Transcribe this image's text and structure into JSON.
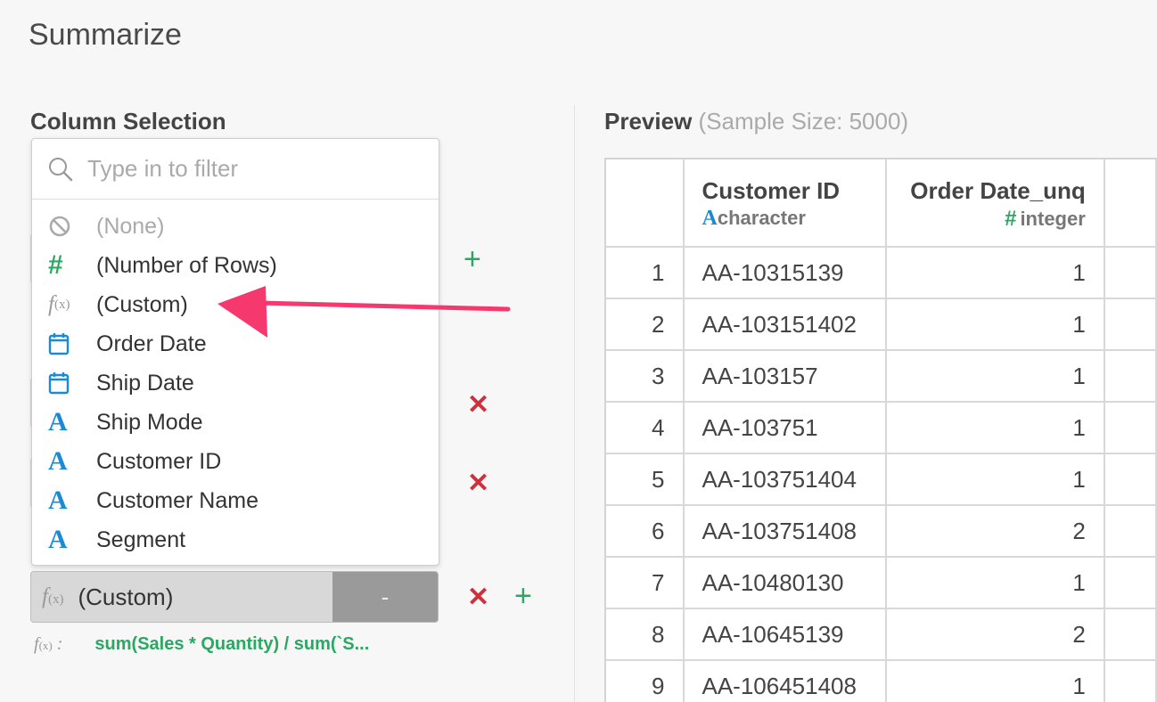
{
  "page": {
    "title": "Summarize"
  },
  "column_selection": {
    "title": "Column Selection",
    "search": {
      "placeholder": "Type in to filter",
      "value": ""
    },
    "options": [
      {
        "label": "(None)",
        "icon": "none-icon"
      },
      {
        "label": "(Number of Rows)",
        "icon": "hash-icon"
      },
      {
        "label": "(Custom)",
        "icon": "function-icon"
      },
      {
        "label": "Order Date",
        "icon": "calendar-icon"
      },
      {
        "label": "Ship Date",
        "icon": "calendar-icon"
      },
      {
        "label": "Ship Mode",
        "icon": "character-icon"
      },
      {
        "label": "Customer ID",
        "icon": "character-icon"
      },
      {
        "label": "Customer Name",
        "icon": "character-icon"
      },
      {
        "label": "Segment",
        "icon": "character-icon"
      }
    ],
    "custom_select": {
      "label": "(Custom)",
      "dash": "-"
    },
    "formula": {
      "label": ":",
      "expression": "sum(Sales * Quantity) / sum(`S..."
    }
  },
  "preview": {
    "title": "Preview",
    "sample": "(Sample Size: 5000)",
    "columns": [
      {
        "name": "Customer ID",
        "type": "character"
      },
      {
        "name": "Order Date_unq",
        "type": "integer"
      }
    ],
    "rows": [
      {
        "n": "1",
        "customer_id": "AA-10315139",
        "order_date_unq": "1"
      },
      {
        "n": "2",
        "customer_id": "AA-103151402",
        "order_date_unq": "1"
      },
      {
        "n": "3",
        "customer_id": "AA-103157",
        "order_date_unq": "1"
      },
      {
        "n": "4",
        "customer_id": "AA-103751",
        "order_date_unq": "1"
      },
      {
        "n": "5",
        "customer_id": "AA-103751404",
        "order_date_unq": "1"
      },
      {
        "n": "6",
        "customer_id": "AA-103751408",
        "order_date_unq": "2"
      },
      {
        "n": "7",
        "customer_id": "AA-10480130",
        "order_date_unq": "1"
      },
      {
        "n": "8",
        "customer_id": "AA-10645139",
        "order_date_unq": "2"
      },
      {
        "n": "9",
        "customer_id": "AA-106451408",
        "order_date_unq": "1"
      }
    ]
  },
  "colors": {
    "accent_green": "#2aa862",
    "remove_red": "#d0303b",
    "type_blue": "#1a8ad4",
    "arrow_pink": "#f5386e"
  }
}
